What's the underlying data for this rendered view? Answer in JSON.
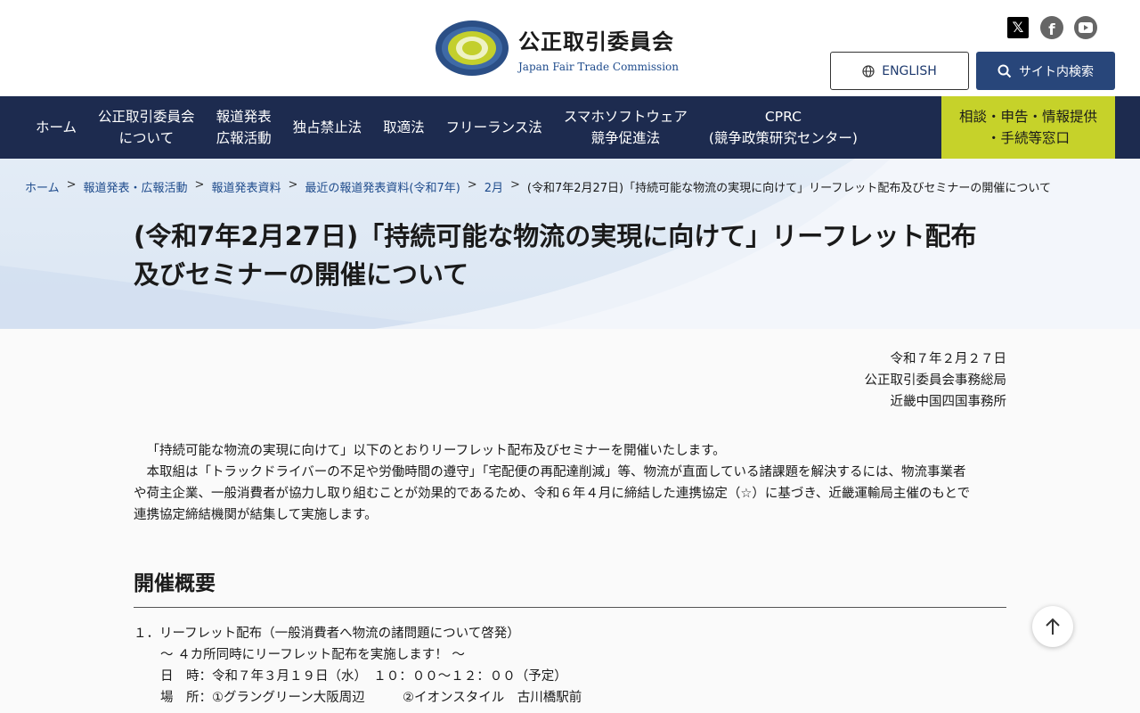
{
  "header": {
    "logo_ja": "公正取引委員会",
    "logo_en": "Japan Fair Trade Commission",
    "english_label": "ENGLISH",
    "search_label": "サイト内検索",
    "social": [
      "x-icon",
      "facebook-icon",
      "youtube-icon"
    ]
  },
  "nav": {
    "items": [
      "ホーム",
      "公正取引委員会\nについて",
      "報道発表\n広報活動",
      "独占禁止法",
      "取適法",
      "フリーランス法",
      "スマホソフトウェア\n競争促進法",
      "CPRC\n(競争政策研究センター)"
    ],
    "consult": "相談・申告・情報提供\n・手続等窓口"
  },
  "breadcrumb": {
    "items": [
      "ホーム",
      "報道発表・広報活動",
      "報道発表資料",
      "最近の報道発表資料(令和7年)",
      "2月"
    ],
    "separator": ">",
    "current": "(令和7年2月27日)「持続可能な物流の実現に向けて」リーフレット配布及びセミナーの開催について"
  },
  "page": {
    "title_line1": "(令和7年2月27日)「持続可能な物流の実現に向けて」リーフレット配布",
    "title_line2": "及びセミナーの開催について"
  },
  "issuer": {
    "date": "令和７年２月２７日",
    "org": "公正取引委員会事務総局",
    "office": "近畿中国四国事務所"
  },
  "intro": {
    "p1": "「持続可能な物流の実現に向けて」以下のとおりリーフレット配布及びセミナーを開催いたします。",
    "p2a": "本取組は「トラックドライバーの不足や労働時間の遵守」「宅配便の再配達削減」等、物流が直面している諸課題を解決するには、物流事業者",
    "p2b": "や荷主企業、一般消費者が協力し取り組むことが効果的であるため、令和６年４月に締結した連携協定（☆）に基づき、近畿運輸局主催のもとで",
    "p2c": "連携協定締結機関が結集して実施します。"
  },
  "section": {
    "heading": "開催概要",
    "item1_title": "１．リーフレット配布（一般消費者へ物流の諸問題について啓発）",
    "item1_sub": "～ ４カ所同時にリーフレット配布を実施します！ ～",
    "item1_date": "日　時：令和７年３月１９日（水）　１０：００～１２：００（予定）",
    "item1_place_a": "場　所：①グラングリーン大阪周辺",
    "item1_place_b": "②イオンスタイル　古川橋駅前"
  },
  "colors": {
    "nav_bg": "#1d2b4f",
    "consult_bg": "#c6d22a",
    "search_bg": "#28467a",
    "link": "#1e4b8c"
  }
}
